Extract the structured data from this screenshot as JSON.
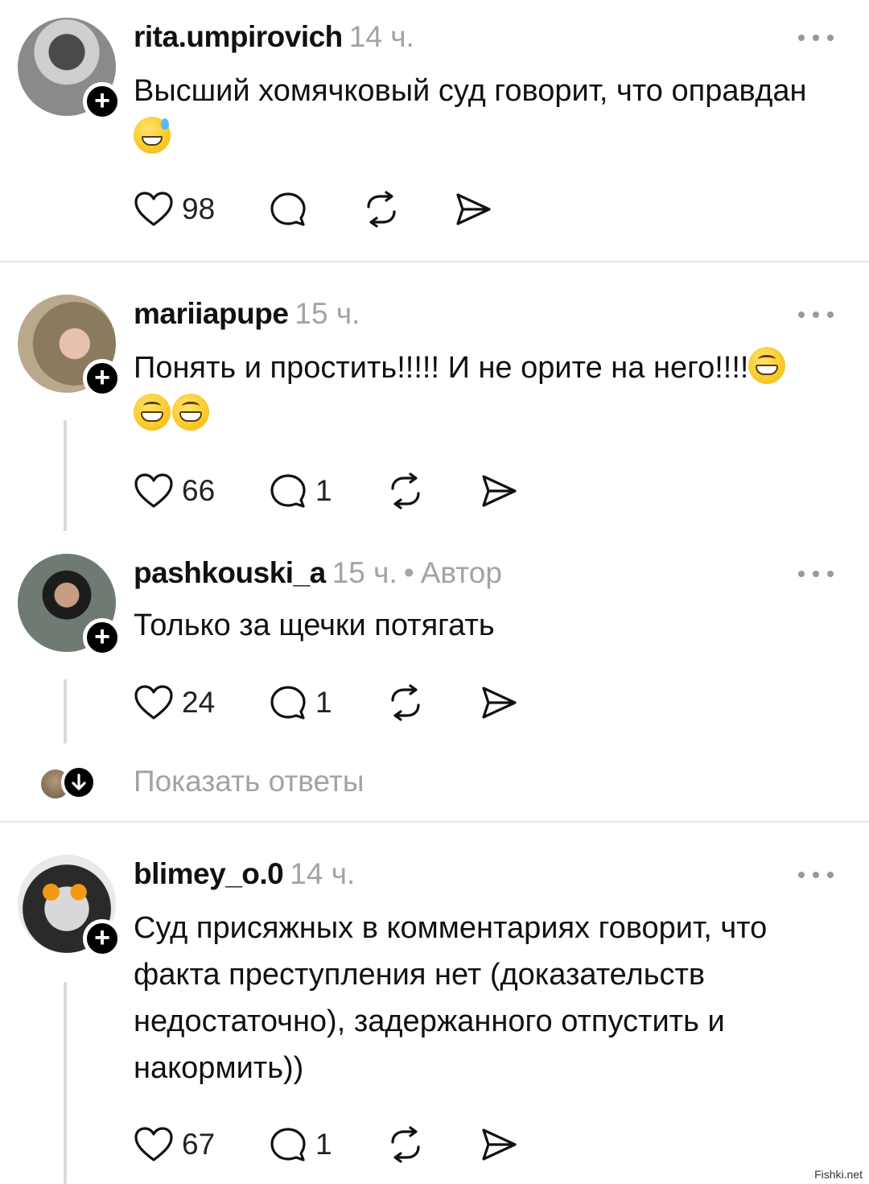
{
  "comments": [
    {
      "username": "rita.umpirovich",
      "time": "14 ч.",
      "text": "Высший хомячковый суд говорит, что оправдан 😅",
      "text_main": "Высший хомячковый суд говорит, что оправдан",
      "likes": "98",
      "replies": ""
    },
    {
      "username": "mariiapupe",
      "time": "15 ч.",
      "text": "Понять и простить!!!!! И не орите на него!!!!😁😁😁",
      "text_main": "Понять и простить!!!!! И не орите на него!!!!",
      "likes": "66",
      "replies": "1"
    },
    {
      "username": "pashkouski_a",
      "time": "15 ч.",
      "author_tag": "Автор",
      "text": "Только за щечки потягать",
      "likes": "24",
      "replies": "1"
    },
    {
      "username": "blimey_o.0",
      "time": "14 ч.",
      "text": "Суд присяжных в комментариях говорит, что факта преступления нет (доказательств недостаточно), задержанного отпустить и накормить))",
      "likes": "67",
      "replies": "1"
    }
  ],
  "separator": "•",
  "show_replies": "Показать ответы",
  "follow_symbol": "+",
  "icons": [
    "heart-icon",
    "comment-icon",
    "repost-icon",
    "share-icon",
    "more-icon",
    "arrow-down-icon"
  ],
  "watermark": "Fishki.net"
}
